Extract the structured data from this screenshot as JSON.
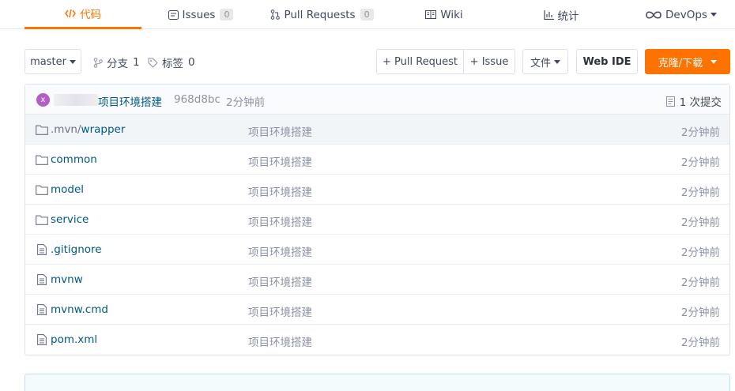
{
  "tabs": [
    {
      "label": "代码",
      "icon": "code-icon"
    },
    {
      "label": "Issues",
      "count": "0",
      "icon": "issues-icon"
    },
    {
      "label": "Pull Requests",
      "count": "0",
      "icon": "pull-request-icon"
    },
    {
      "label": "Wiki",
      "icon": "wiki-icon"
    },
    {
      "label": "统计",
      "icon": "stats-icon"
    },
    {
      "label": "DevOps",
      "icon": "infinity-icon"
    }
  ],
  "toolbar": {
    "branch_select": "master",
    "branches_label": "分支",
    "branches_count": "1",
    "tags_label": "标签",
    "tags_count": "0",
    "pull_request_label": "+ Pull Request",
    "issue_label": "+ Issue",
    "files_label": "文件",
    "web_ide_label": "Web IDE",
    "clone_label": "克隆/下载"
  },
  "commit": {
    "avatar_letter": "x",
    "message": "项目环境搭建",
    "hash": "968d8bc",
    "time": "2分钟前",
    "commits_count": "1 次提交"
  },
  "files": [
    {
      "type": "folder",
      "name_prefix": ".mvn/",
      "name_rest": "wrapper",
      "message": "项目环境搭建",
      "time": "2分钟前"
    },
    {
      "type": "folder",
      "name_prefix": "common",
      "name_rest": "",
      "message": "项目环境搭建",
      "time": "2分钟前"
    },
    {
      "type": "folder",
      "name_prefix": "model",
      "name_rest": "",
      "message": "项目环境搭建",
      "time": "2分钟前"
    },
    {
      "type": "folder",
      "name_prefix": "service",
      "name_rest": "",
      "message": "项目环境搭建",
      "time": "2分钟前"
    },
    {
      "type": "file",
      "name_prefix": ".gitignore",
      "name_rest": "",
      "message": "项目环境搭建",
      "time": "2分钟前"
    },
    {
      "type": "file",
      "name_prefix": "mvnw",
      "name_rest": "",
      "message": "项目环境搭建",
      "time": "2分钟前"
    },
    {
      "type": "file",
      "name_prefix": "mvnw.cmd",
      "name_rest": "",
      "message": "项目环境搭建",
      "time": "2分钟前"
    },
    {
      "type": "file",
      "name_prefix": "pom.xml",
      "name_rest": "",
      "message": "项目环境搭建",
      "time": "2分钟前"
    }
  ],
  "colors": {
    "accent": "#fe7300",
    "link": "#005980",
    "muted": "#8c92a4"
  }
}
